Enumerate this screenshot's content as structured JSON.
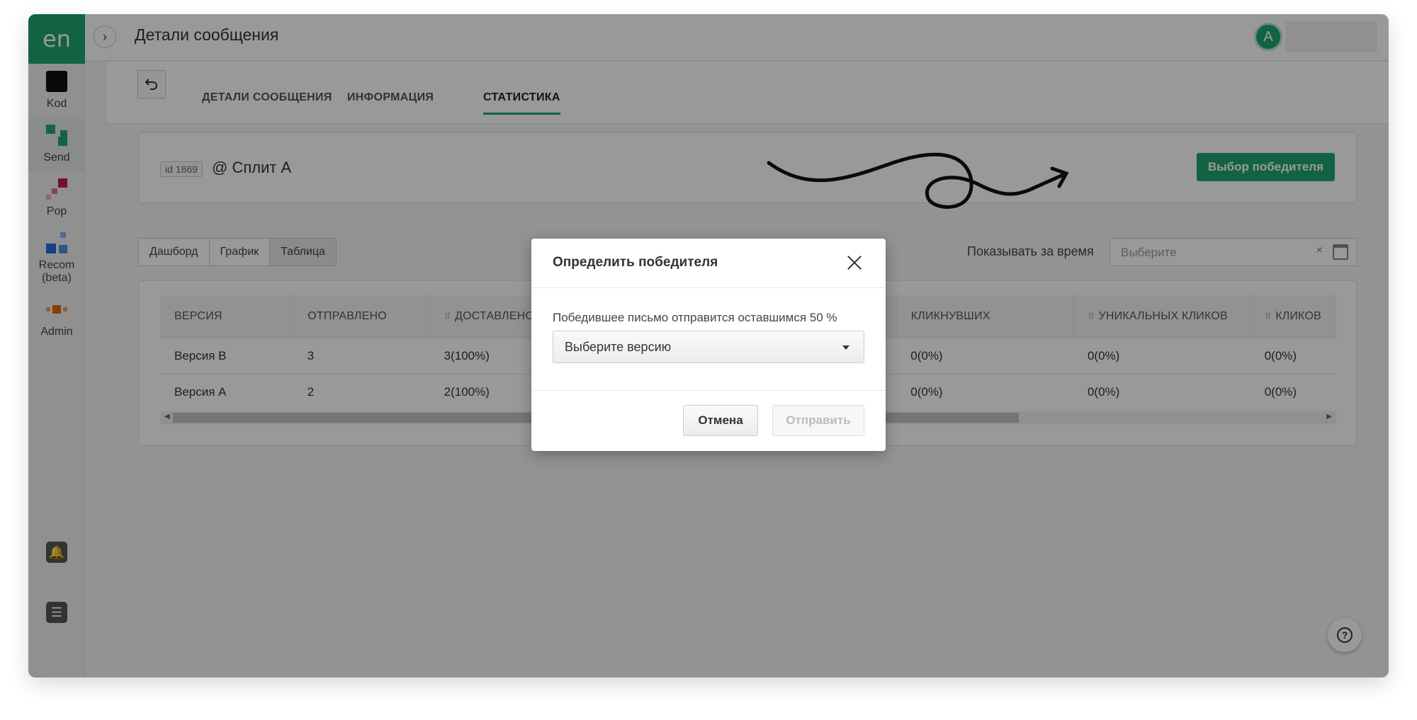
{
  "logo": "en",
  "sidebar": {
    "items": [
      {
        "label": "Kod"
      },
      {
        "label": "Send"
      },
      {
        "label": "Pop"
      },
      {
        "label": "Recom (beta)"
      },
      {
        "label": "Admin"
      }
    ]
  },
  "header": {
    "title": "Детали сообщения",
    "avatar_letter": "A"
  },
  "tabs": [
    {
      "label": "ДЕТАЛИ СООБЩЕНИЯ"
    },
    {
      "label": "ИНФОРМАЦИЯ"
    },
    {
      "label": "СТАТИСТИКА",
      "active": true
    }
  ],
  "card": {
    "id_badge": "id 1869",
    "name": "@ Сплит А",
    "winner_button": "Выбор победителя"
  },
  "views": [
    "Дашборд",
    "График",
    "Таблица"
  ],
  "period": {
    "label": "Показывать за время",
    "placeholder": "Выберите",
    "clear": "×"
  },
  "table": {
    "columns": [
      "ВЕРСИЯ",
      "ОТПРАВЛЕНО",
      "ДОСТАВЛЕНО",
      "КЛИКНУВШИХ",
      "УНИКАЛЬНЫХ КЛИКОВ",
      "КЛИКОВ"
    ],
    "rows": [
      [
        "Версия B",
        "3",
        "3(100%)",
        "0(0%)",
        "0(0%)",
        "0(0%)"
      ],
      [
        "Версия A",
        "2",
        "2(100%)",
        "0(0%)",
        "0(0%)",
        "0(0%)"
      ]
    ]
  },
  "modal": {
    "title": "Определить победителя",
    "text": "Победившее письмо отправится оставшимся 50 %",
    "select_value": "Выберите версию",
    "cancel": "Отмена",
    "send": "Отправить"
  },
  "colors": {
    "accent": "#1fa571"
  }
}
